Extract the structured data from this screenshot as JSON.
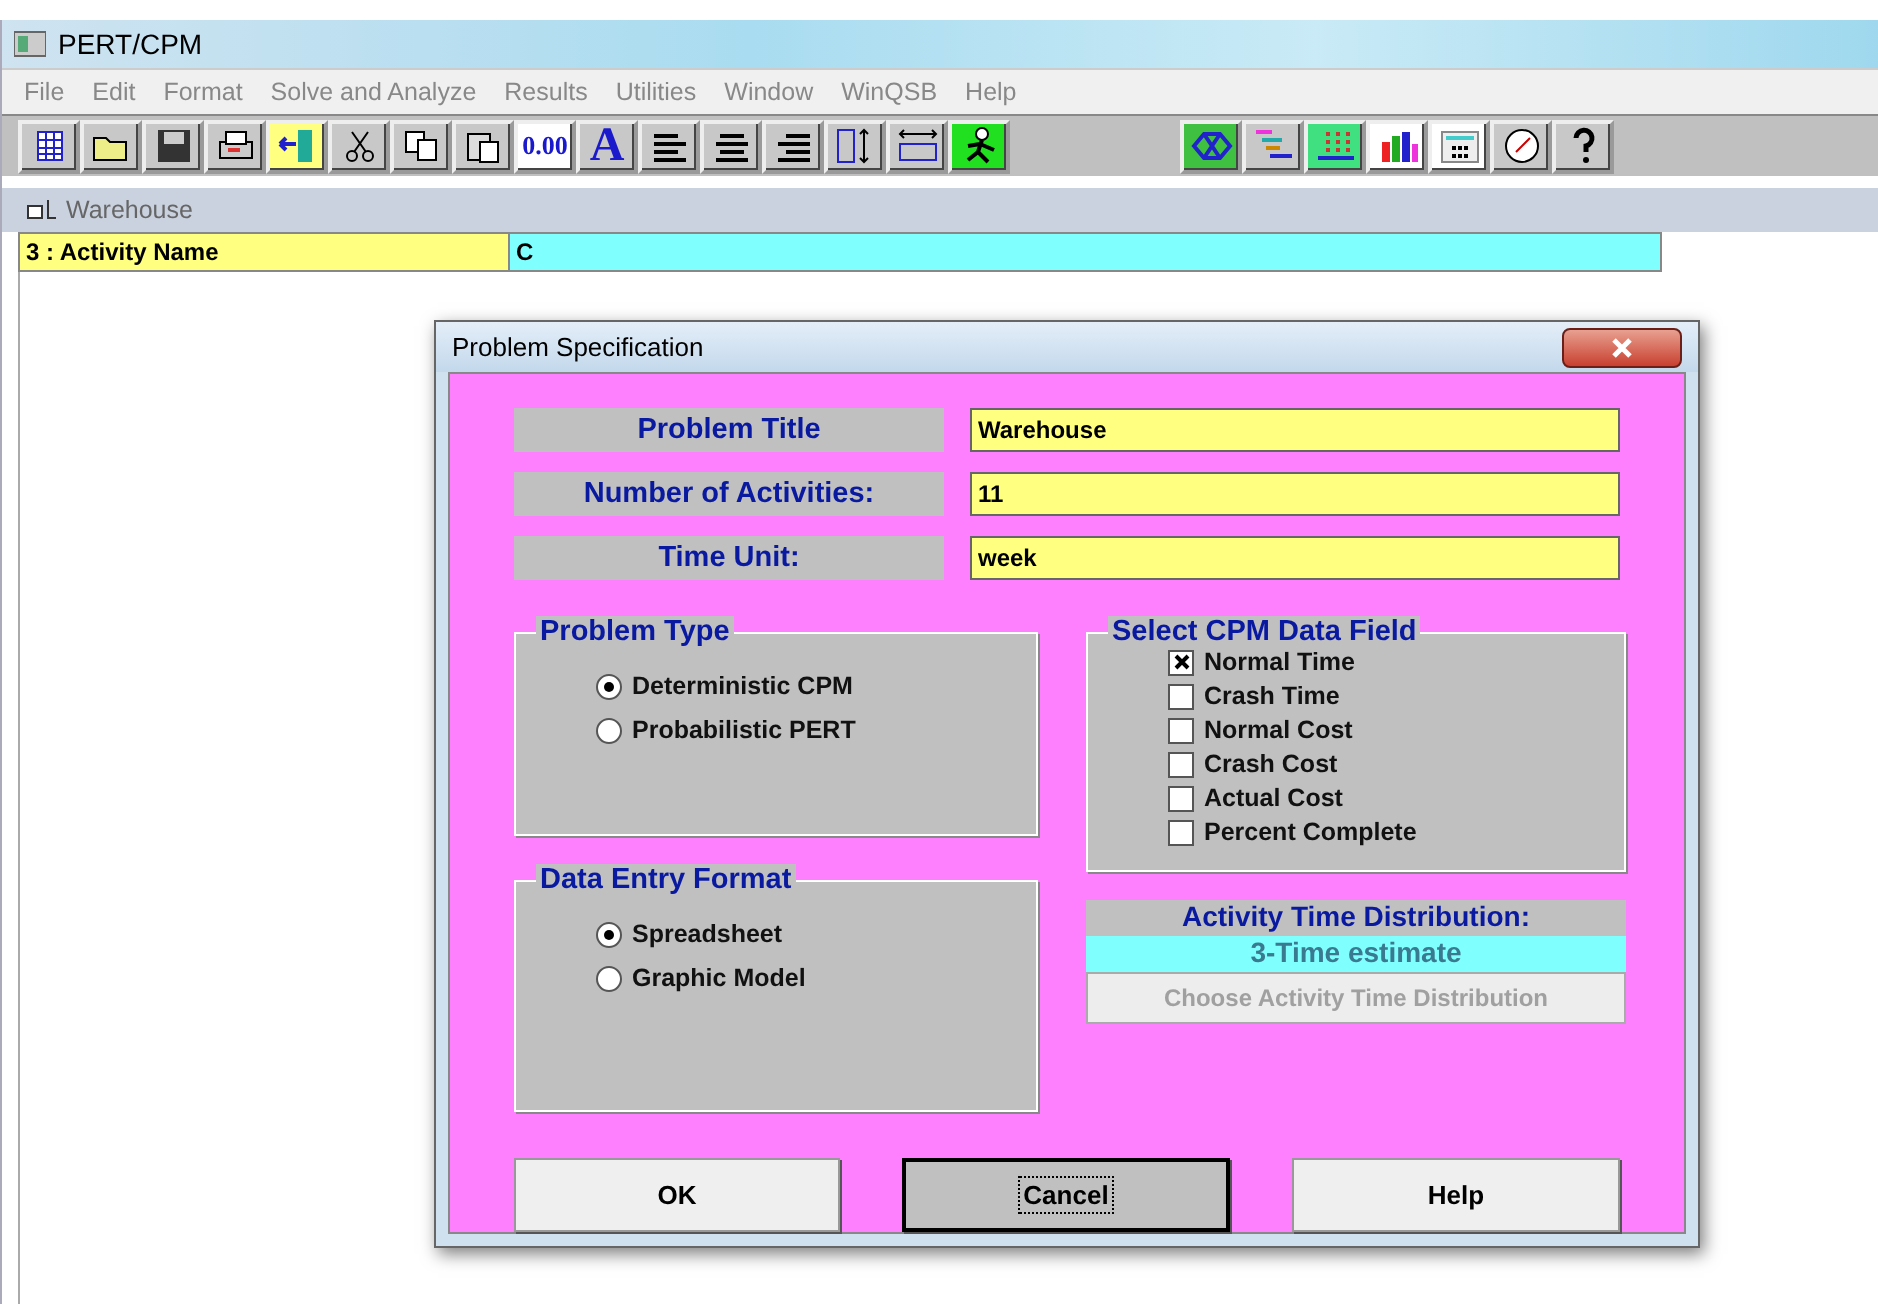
{
  "window": {
    "title": "PERT/CPM"
  },
  "menu": [
    "File",
    "Edit",
    "Format",
    "Solve and Analyze",
    "Results",
    "Utilities",
    "Window",
    "WinQSB",
    "Help"
  ],
  "toolbar": [
    {
      "kind": "grid"
    },
    {
      "kind": "open"
    },
    {
      "kind": "save"
    },
    {
      "kind": "print"
    },
    {
      "kind": "exit"
    },
    {
      "kind": "cut"
    },
    {
      "kind": "copy"
    },
    {
      "kind": "paste"
    },
    {
      "kind": "number",
      "label": "0.00"
    },
    {
      "kind": "font",
      "label": "A"
    },
    {
      "kind": "align-left"
    },
    {
      "kind": "align-center"
    },
    {
      "kind": "align-right"
    },
    {
      "kind": "row-height"
    },
    {
      "kind": "column-width"
    },
    {
      "kind": "runner"
    },
    {
      "kind": "gap"
    },
    {
      "kind": "network"
    },
    {
      "kind": "gantt"
    },
    {
      "kind": "dots"
    },
    {
      "kind": "bars"
    },
    {
      "kind": "calculator"
    },
    {
      "kind": "clock"
    },
    {
      "kind": "help"
    }
  ],
  "document": {
    "title": "Warehouse",
    "row": {
      "label": "3 : Activity Name",
      "value": "C"
    }
  },
  "dialog": {
    "title": "Problem Specification",
    "fields": [
      {
        "label": "Problem Title",
        "value": "Warehouse"
      },
      {
        "label": "Number of Activities:",
        "value": "11"
      },
      {
        "label": "Time Unit:",
        "value": "week"
      }
    ],
    "problem_type": {
      "title": "Problem Type",
      "options": [
        {
          "label": "Deterministic CPM",
          "selected": true
        },
        {
          "label": "Probabilistic PERT",
          "selected": false
        }
      ]
    },
    "data_entry": {
      "title": "Data Entry Format",
      "options": [
        {
          "label": "Spreadsheet",
          "selected": true
        },
        {
          "label": "Graphic Model",
          "selected": false
        }
      ]
    },
    "cpm_fields": {
      "title": "Select CPM Data Field",
      "items": [
        {
          "label": "Normal Time",
          "checked": true
        },
        {
          "label": "Crash Time",
          "checked": false
        },
        {
          "label": "Normal Cost",
          "checked": false
        },
        {
          "label": "Crash Cost",
          "checked": false
        },
        {
          "label": "Actual Cost",
          "checked": false
        },
        {
          "label": "Percent Complete",
          "checked": false
        }
      ]
    },
    "distribution": {
      "title": "Activity Time Distribution:",
      "value": "3-Time estimate",
      "button": {
        "label": "Choose Activity Time Distribution",
        "disabled": true
      }
    },
    "buttons": [
      {
        "label": "OK",
        "focused": false
      },
      {
        "label": "Cancel",
        "focused": true
      },
      {
        "label": "Help",
        "focused": false
      }
    ]
  }
}
